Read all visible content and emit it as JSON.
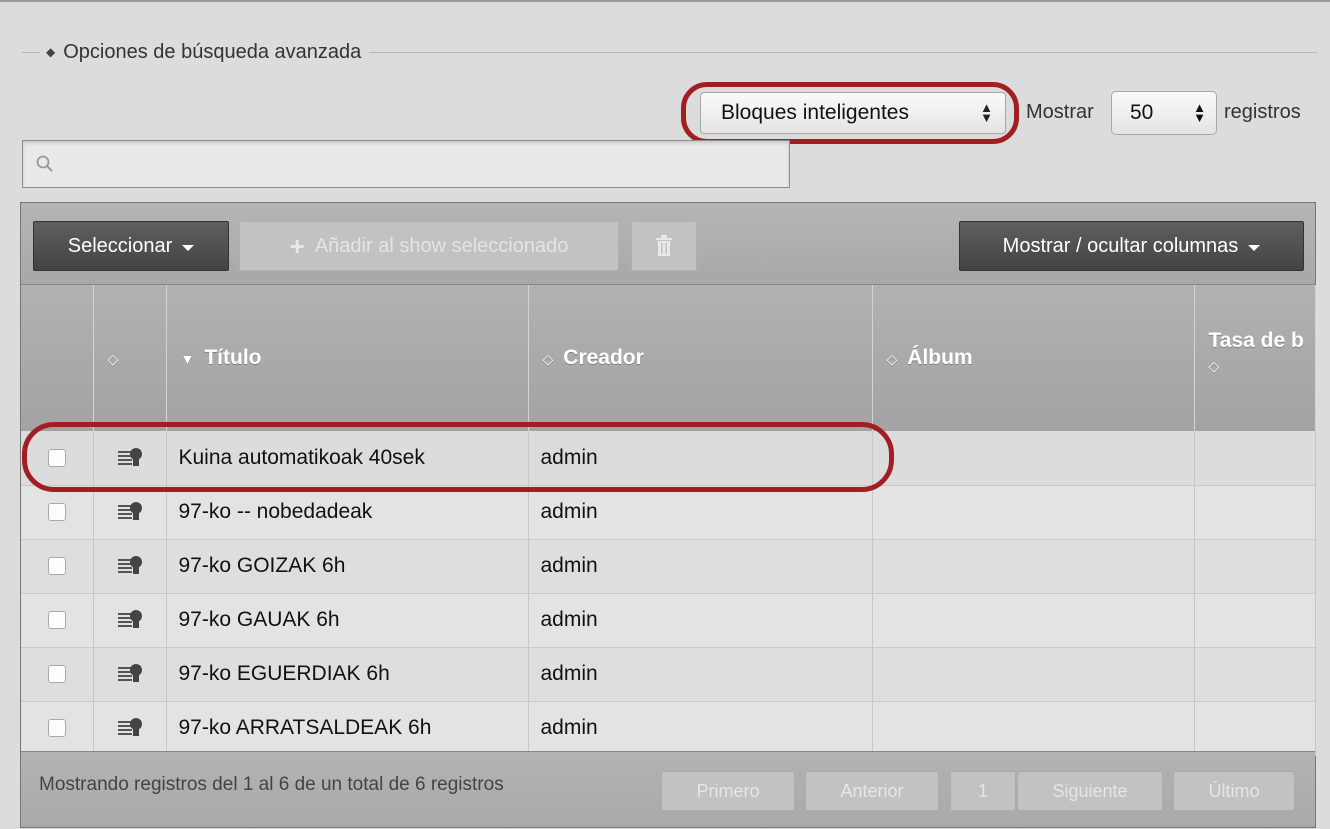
{
  "search_options": {
    "legend": "Opciones de búsqueda avanzada",
    "type_select_value": "Bloques inteligentes",
    "show_label": "Mostrar",
    "count_select_value": "50",
    "records_label": "registros",
    "search_placeholder": ""
  },
  "toolbar": {
    "select_label": "Seleccionar",
    "add_label": "Añadir al show seleccionado",
    "columns_label": "Mostrar / ocultar columnas"
  },
  "table": {
    "headers": {
      "title": "Título",
      "creator": "Creador",
      "album": "Álbum",
      "bitrate": "Tasa de b"
    },
    "rows": [
      {
        "title": "Kuina automatikoak 40sek",
        "creator": "admin",
        "album": "",
        "bitrate": ""
      },
      {
        "title": "97-ko -- nobedadeak",
        "creator": "admin",
        "album": "",
        "bitrate": ""
      },
      {
        "title": "97-ko GOIZAK 6h",
        "creator": "admin",
        "album": "",
        "bitrate": ""
      },
      {
        "title": "97-ko GAUAK 6h",
        "creator": "admin",
        "album": "",
        "bitrate": ""
      },
      {
        "title": "97-ko EGUERDIAK 6h",
        "creator": "admin",
        "album": "",
        "bitrate": ""
      },
      {
        "title": "97-ko ARRATSALDEAK 6h",
        "creator": "admin",
        "album": "",
        "bitrate": ""
      }
    ]
  },
  "footer": {
    "info": "Mostrando registros del 1 al 6 de un total de 6 registros",
    "first": "Primero",
    "previous": "Anterior",
    "page": "1",
    "next": "Siguiente",
    "last": "Último"
  },
  "colors": {
    "highlight": "#a31e22",
    "toolbar_dark": "#4a4a4a"
  }
}
